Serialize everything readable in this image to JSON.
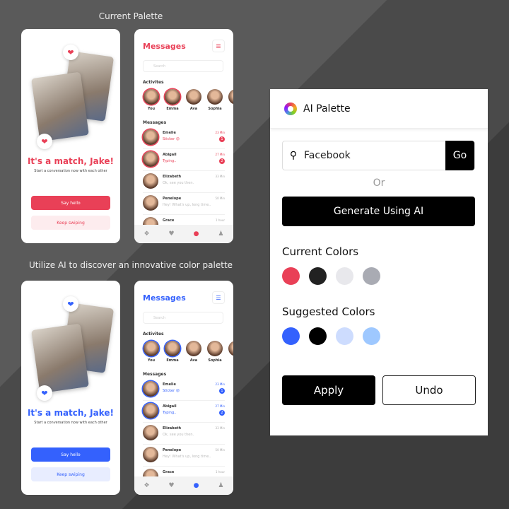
{
  "captions": {
    "current": "Current Palette",
    "ai": "Utilize AI to discover an innovative color palette"
  },
  "mockups": [
    {
      "accent": "#e94057",
      "light": "#fdecee",
      "accent_text": "#e94057"
    },
    {
      "accent": "#3461fd",
      "light": "#e8edff",
      "accent_text": "#3461fd"
    }
  ],
  "match": {
    "title": "It's a match, Jake!",
    "subtitle": "Start a conversation now with each other",
    "say_hello": "Say hello",
    "keep_swiping": "Keep swiping"
  },
  "messages": {
    "title": "Messages",
    "search_placeholder": "Search",
    "activities_label": "Activites",
    "messages_label": "Messages",
    "activities": [
      "You",
      "Emma",
      "Ava",
      "Sophia"
    ],
    "threads": [
      {
        "name": "Emelie",
        "preview": "Sticker 😛",
        "time": "23 Min",
        "badge": "1",
        "active": true
      },
      {
        "name": "Abigail",
        "preview": "Typing..",
        "time": "27 Min",
        "badge": "2",
        "active": true
      },
      {
        "name": "Elizabeth",
        "preview": "Ok, see you then.",
        "time": "33 Min",
        "badge": "",
        "active": false
      },
      {
        "name": "Penelope",
        "preview": "Hey! What's up, long time..",
        "time": "50 Min",
        "badge": "",
        "active": false
      },
      {
        "name": "Grace",
        "preview": "",
        "time": "1 hour",
        "badge": "",
        "active": false
      }
    ]
  },
  "panel": {
    "title": "AI Palette",
    "search_value": "Facebook",
    "go": "Go",
    "or": "Or",
    "generate": "Generate Using AI",
    "current_label": "Current Colors",
    "current_colors": [
      "#e94057",
      "#222222",
      "#e8e8ec",
      "#a9abb3"
    ],
    "suggested_label": "Suggested Colors",
    "suggested_colors": [
      "#3461fd",
      "#000000",
      "#cddcfe",
      "#9ec8ff"
    ],
    "apply": "Apply",
    "undo": "Undo"
  }
}
